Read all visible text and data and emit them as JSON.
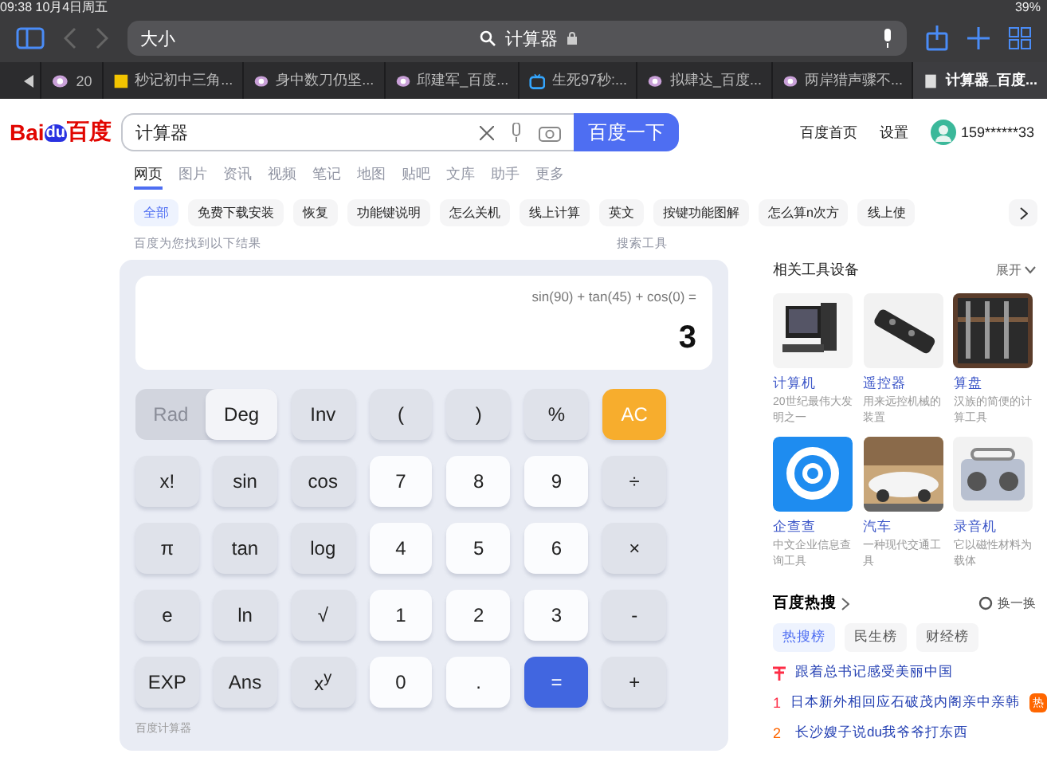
{
  "status_bar": {
    "time": "09:38",
    "date": "10月4日周五",
    "battery": "39%"
  },
  "toolbar": {
    "reader_label": "大小",
    "address": "计算器"
  },
  "browser_tabs": [
    {
      "title": "20",
      "kind": "paw",
      "selected": false
    },
    {
      "title": "秒记初中三角...",
      "kind": "square",
      "selected": false
    },
    {
      "title": "身中数刀仍坚...",
      "kind": "paw",
      "selected": false
    },
    {
      "title": "邱建军_百度...",
      "kind": "paw",
      "selected": false
    },
    {
      "title": "生死97秒:...",
      "kind": "tv",
      "selected": false
    },
    {
      "title": "拟肆达_百度...",
      "kind": "paw",
      "selected": false
    },
    {
      "title": "两岸猎声骤不...",
      "kind": "paw",
      "selected": false
    },
    {
      "title": "计算器_百度...",
      "kind": "page",
      "selected": true
    }
  ],
  "logo": {
    "left": "Bai",
    "paw": "du",
    "right": "百度"
  },
  "search": {
    "value": "计算器",
    "button": "百度一下"
  },
  "user_links": [
    "百度首页",
    "设置"
  ],
  "user": {
    "name": "159******33"
  },
  "nav_tabs": [
    {
      "label": "网页",
      "selected": true
    },
    {
      "label": "图片",
      "selected": false
    },
    {
      "label": "资讯",
      "selected": false
    },
    {
      "label": "视频",
      "selected": false
    },
    {
      "label": "笔记",
      "selected": false
    },
    {
      "label": "地图",
      "selected": false
    },
    {
      "label": "贴吧",
      "selected": false
    },
    {
      "label": "文库",
      "selected": false
    },
    {
      "label": "助手",
      "selected": false
    },
    {
      "label": "更多",
      "selected": false
    }
  ],
  "chips": [
    {
      "label": "全部",
      "selected": true
    },
    {
      "label": "免费下载安装",
      "selected": false
    },
    {
      "label": "恢复",
      "selected": false
    },
    {
      "label": "功能键说明",
      "selected": false
    },
    {
      "label": "怎么关机",
      "selected": false
    },
    {
      "label": "线上计算",
      "selected": false
    },
    {
      "label": "英文",
      "selected": false
    },
    {
      "label": "按键功能图解",
      "selected": false
    },
    {
      "label": "怎么算n次方",
      "selected": false
    },
    {
      "label": "线上使",
      "selected": false
    }
  ],
  "result_note": "百度为您找到以下结果",
  "search_tools": "搜索工具",
  "calculator": {
    "expression": "sin(90) + tan(45) + cos(0) =",
    "result": "3",
    "angle_modes": [
      {
        "label": "Rad",
        "selected": false
      },
      {
        "label": "Deg",
        "selected": true
      }
    ],
    "keys": [
      {
        "label": "Inv",
        "kind": "func"
      },
      {
        "label": "(",
        "kind": "func"
      },
      {
        "label": ")",
        "kind": "func"
      },
      {
        "label": "%",
        "kind": "func"
      },
      {
        "label": "AC",
        "kind": "clear"
      },
      {
        "label": "x!",
        "kind": "func"
      },
      {
        "label": "sin",
        "kind": "func"
      },
      {
        "label": "cos",
        "kind": "func"
      },
      {
        "label": "7",
        "kind": "digit"
      },
      {
        "label": "8",
        "kind": "digit"
      },
      {
        "label": "9",
        "kind": "digit"
      },
      {
        "label": "÷",
        "kind": "func"
      },
      {
        "label": "π",
        "kind": "func"
      },
      {
        "label": "tan",
        "kind": "func"
      },
      {
        "label": "log",
        "kind": "func"
      },
      {
        "label": "4",
        "kind": "digit"
      },
      {
        "label": "5",
        "kind": "digit"
      },
      {
        "label": "6",
        "kind": "digit"
      },
      {
        "label": "×",
        "kind": "func"
      },
      {
        "label": "e",
        "kind": "func"
      },
      {
        "label": "ln",
        "kind": "func"
      },
      {
        "label": "√",
        "kind": "func"
      },
      {
        "label": "1",
        "kind": "digit"
      },
      {
        "label": "2",
        "kind": "digit"
      },
      {
        "label": "3",
        "kind": "digit"
      },
      {
        "label": "-",
        "kind": "func"
      },
      {
        "label": "EXP",
        "kind": "func"
      },
      {
        "label": "Ans",
        "kind": "func"
      },
      {
        "label": "x$^{y}$",
        "kind": "func"
      },
      {
        "label": "0",
        "kind": "digit"
      },
      {
        "label": ".",
        "kind": "digit"
      },
      {
        "label": "=",
        "kind": "equals"
      },
      {
        "label": "+",
        "kind": "func"
      }
    ],
    "footer": "百度计算器"
  },
  "related": {
    "title": "相关工具设备",
    "expand": "展开",
    "items": [
      {
        "name": "计算机",
        "desc": "20世纪最伟大发明之一",
        "kind": "picture"
      },
      {
        "name": "遥控器",
        "desc": "用来远控机械的装置",
        "kind": "picture"
      },
      {
        "name": "算盘",
        "desc": "汉族的简便的计算工具",
        "kind": "picture"
      },
      {
        "name": "企查查",
        "desc": "中文企业信息查询工具",
        "kind": "logo"
      },
      {
        "name": "汽车",
        "desc": "一种现代交通工具",
        "kind": "picture"
      },
      {
        "name": "录音机",
        "desc": "它以磁性材料为载体",
        "kind": "picture"
      }
    ]
  },
  "hot_search": {
    "title": "百度热搜",
    "refresh": "换一换",
    "tabs": [
      {
        "label": "热搜榜",
        "selected": true
      },
      {
        "label": "民生榜",
        "selected": false
      },
      {
        "label": "财经榜",
        "selected": false
      }
    ],
    "items": [
      {
        "kind": "pinned",
        "text": "跟着总书记感受美丽中国"
      },
      {
        "kind": "ranked",
        "rank": "1",
        "text": "日本新外相回应石破茂内阁亲中亲韩",
        "badge": "热"
      },
      {
        "kind": "ranked",
        "rank": "2",
        "text": "长沙嫂子说du我爷爷打东西"
      }
    ]
  }
}
